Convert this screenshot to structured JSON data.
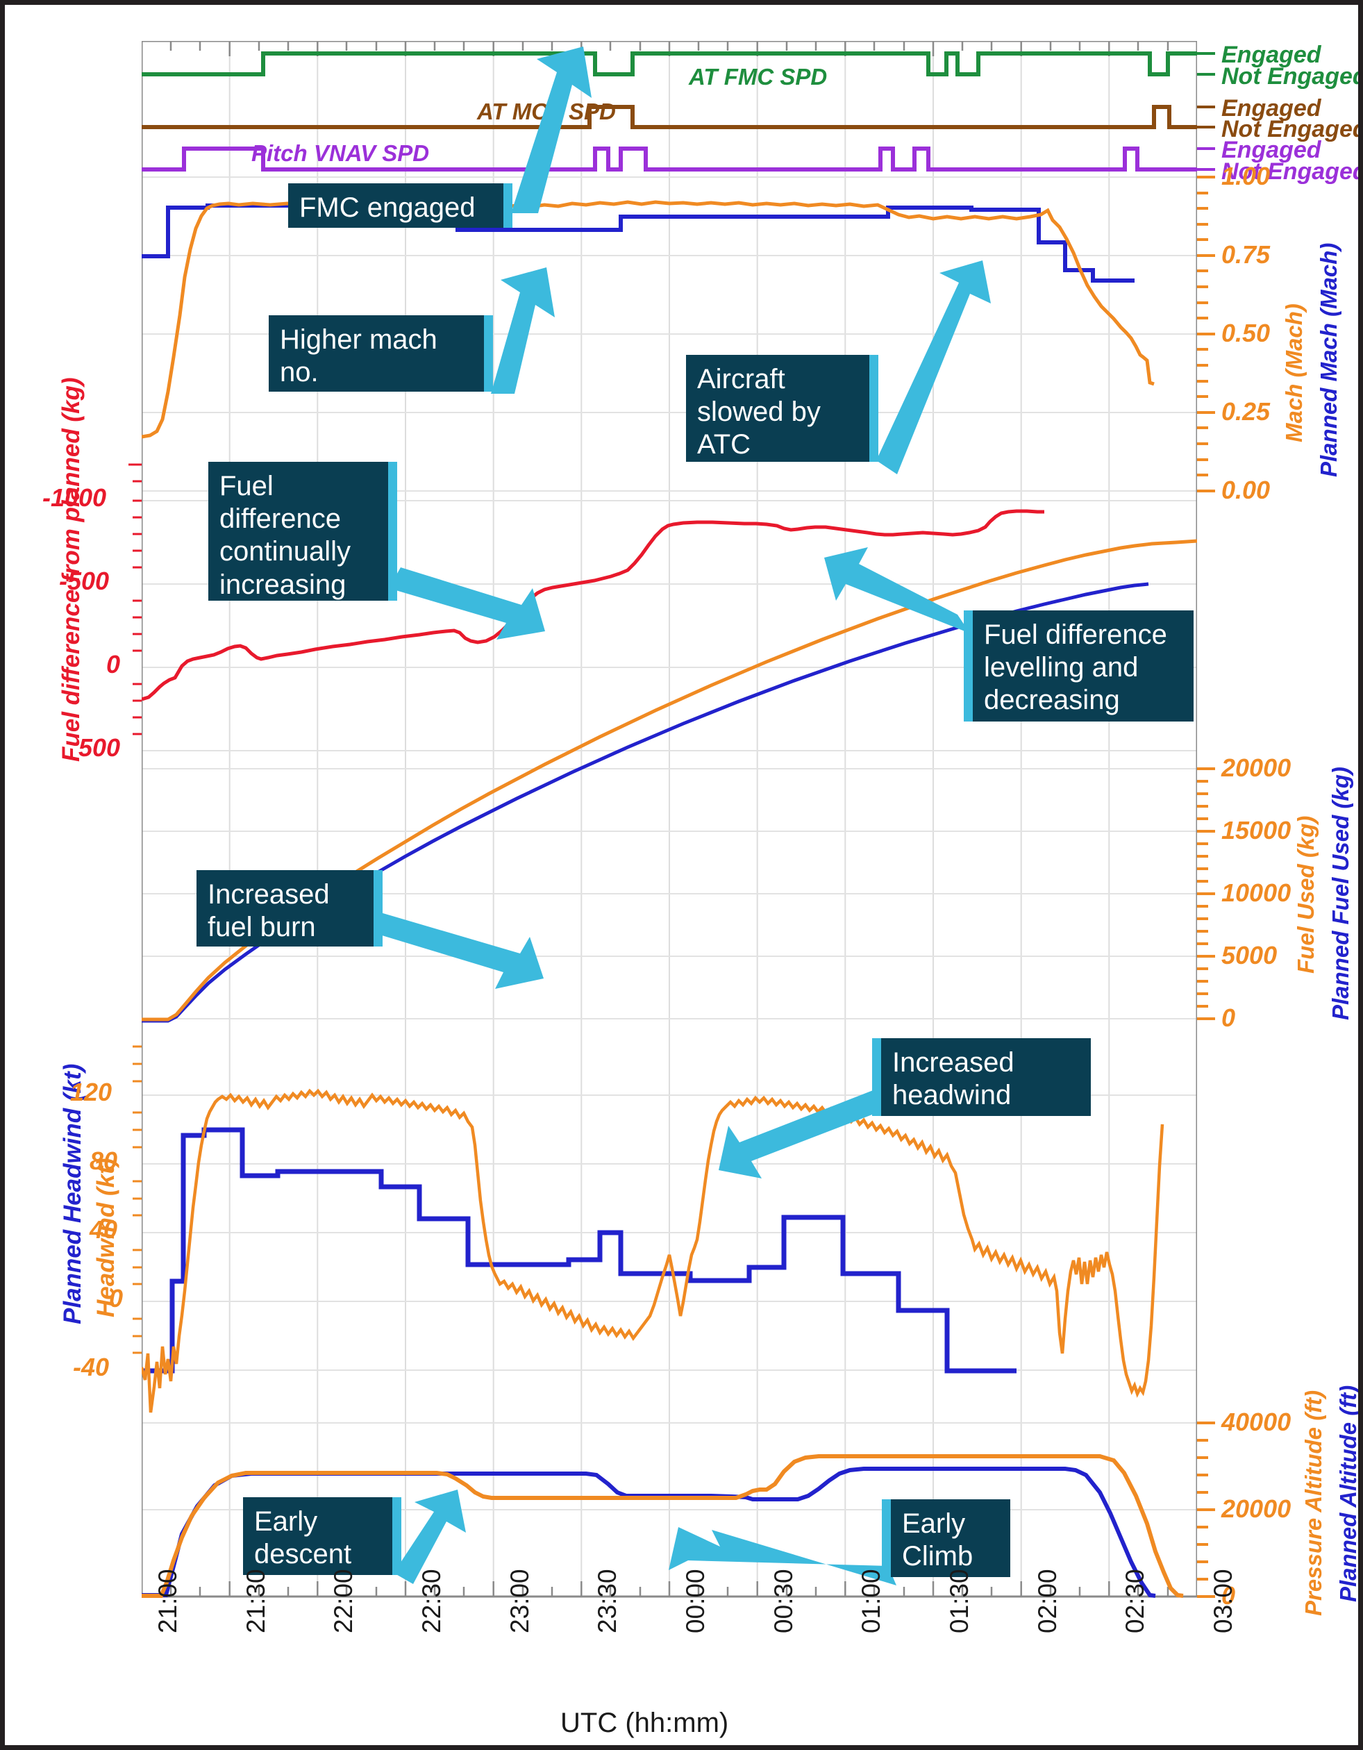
{
  "chart_data": {
    "type": "line",
    "title": "",
    "xlabel": "UTC (hh:mm)",
    "x_ticks": [
      "21:00",
      "21:30",
      "22:00",
      "22:30",
      "23:00",
      "23:30",
      "00:00",
      "00:30",
      "01:00",
      "01:30",
      "02:00",
      "02:30",
      "03:00"
    ],
    "x_range": [
      "21:00",
      "03:00"
    ],
    "grid": true,
    "panels": [
      {
        "name": "autopilot-modes",
        "axes": [
          {
            "side": "right",
            "label": "AT FMC SPD",
            "color": "#1e8e3e",
            "ticks": [
              "Engaged",
              "Not Engaged"
            ]
          },
          {
            "side": "right",
            "label": "AT MCP SPD",
            "color": "#8a4b10",
            "ticks": [
              "Engaged",
              "Not Engaged"
            ]
          },
          {
            "side": "right",
            "label": "Pitch VNAV SPD",
            "color": "#9b30d9",
            "ticks": [
              "Engaged",
              "Not Engaged"
            ]
          }
        ],
        "series": [
          {
            "name": "AT FMC SPD",
            "color": "#1e8e3e",
            "type": "step",
            "states": [
              [
                0.0,
                0
              ],
              [
                0.115,
                1
              ],
              [
                0.43,
                0
              ],
              [
                0.465,
                1
              ],
              [
                0.745,
                0
              ],
              [
                0.762,
                1
              ],
              [
                0.775,
                0
              ],
              [
                0.792,
                1
              ],
              [
                0.955,
                0
              ],
              [
                0.968,
                1
              ],
              [
                1.0,
                1
              ]
            ]
          },
          {
            "name": "AT MCP SPD",
            "color": "#8a4b10",
            "type": "step",
            "states": [
              [
                0.0,
                0
              ],
              [
                0.425,
                1
              ],
              [
                0.465,
                0
              ],
              [
                0.955,
                0
              ],
              [
                0.962,
                1
              ],
              [
                0.975,
                0
              ],
              [
                1.0,
                0
              ]
            ]
          },
          {
            "name": "Pitch VNAV SPD",
            "color": "#9b30d9",
            "type": "step",
            "states": [
              [
                0.0,
                0
              ],
              [
                0.04,
                1
              ],
              [
                0.115,
                0
              ],
              [
                0.425,
                0
              ],
              [
                0.435,
                1
              ],
              [
                0.448,
                0
              ],
              [
                0.458,
                1
              ],
              [
                0.478,
                0
              ],
              [
                0.7,
                1
              ],
              [
                0.712,
                0
              ],
              [
                0.728,
                1
              ],
              [
                0.742,
                0
              ],
              [
                0.93,
                1
              ],
              [
                0.94,
                0
              ],
              [
                1.0,
                0
              ]
            ]
          }
        ]
      },
      {
        "name": "mach",
        "axes": [
          {
            "side": "right",
            "label": "Mach (Mach)",
            "color": "#f08a22",
            "ticks": [
              "0.00",
              "0.25",
              "0.50",
              "0.75",
              "1.00"
            ],
            "range": [
              0,
              1
            ]
          },
          {
            "side": "right",
            "label": "Planned Mach (Mach)",
            "color": "#2222cc",
            "ticks": [
              "0.00",
              "0.25",
              "0.50",
              "0.75",
              "1.00"
            ],
            "range": [
              0,
              1
            ]
          }
        ],
        "series": [
          {
            "name": "Mach",
            "color": "#f08a22",
            "units": "Mach"
          },
          {
            "name": "Planned Mach",
            "color": "#2222cc",
            "units": "Mach"
          }
        ]
      },
      {
        "name": "fuel-difference",
        "axes": [
          {
            "side": "left",
            "label": "Fuel difference from planned (kg)",
            "color": "#e8192c",
            "ticks": [
              "-1000",
              "-500",
              "0",
              "500"
            ],
            "range": [
              500,
              -1000
            ],
            "inverted": true
          }
        ],
        "series": [
          {
            "name": "Fuel difference from planned",
            "color": "#e8192c",
            "units": "kg"
          }
        ]
      },
      {
        "name": "fuel-used",
        "axes": [
          {
            "side": "right",
            "label": "Fuel Used (kg)",
            "color": "#f08a22",
            "ticks": [
              "0",
              "5000",
              "10000",
              "15000",
              "20000"
            ],
            "range": [
              0,
              20000
            ]
          },
          {
            "side": "right",
            "label": "Planned Fuel Used (kg)",
            "color": "#2222cc",
            "ticks": [
              "0",
              "5000",
              "10000",
              "15000",
              "20000"
            ],
            "range": [
              0,
              20000
            ]
          }
        ],
        "series": [
          {
            "name": "Fuel Used",
            "color": "#f08a22",
            "units": "kg"
          },
          {
            "name": "Planned Fuel Used",
            "color": "#2222cc",
            "units": "kg"
          }
        ]
      },
      {
        "name": "headwind",
        "axes": [
          {
            "side": "left",
            "label": "Headwind (kt)",
            "color": "#f08a22",
            "ticks": [
              "-40",
              "0",
              "40",
              "80",
              "120"
            ],
            "range": [
              -40,
              120
            ]
          },
          {
            "side": "left",
            "label": "Planned Headwind (kt)",
            "color": "#2222cc",
            "ticks": [
              "-40",
              "0",
              "40",
              "80",
              "120"
            ],
            "range": [
              -40,
              120
            ]
          }
        ],
        "series": [
          {
            "name": "Headwind",
            "color": "#f08a22",
            "units": "kt"
          },
          {
            "name": "Planned Headwind",
            "color": "#2222cc",
            "units": "kt"
          }
        ]
      },
      {
        "name": "altitude",
        "axes": [
          {
            "side": "right",
            "label": "Pressure Altitude (ft)",
            "color": "#f08a22",
            "ticks": [
              "0",
              "20000",
              "40000"
            ],
            "range": [
              0,
              40000
            ]
          },
          {
            "side": "right",
            "label": "Planned Altitude (ft)",
            "color": "#2222cc",
            "ticks": [
              "0",
              "20000",
              "40000"
            ],
            "range": [
              0,
              40000
            ]
          }
        ],
        "series": [
          {
            "name": "Pressure Altitude",
            "color": "#f08a22",
            "units": "ft"
          },
          {
            "name": "Planned Altitude",
            "color": "#2222cc",
            "units": "ft"
          }
        ]
      }
    ],
    "annotations": [
      {
        "id": "fmc-engaged",
        "text": "FMC engaged",
        "bar": "right"
      },
      {
        "id": "higher-mach-no",
        "text": "Higher mach no.",
        "bar": "right"
      },
      {
        "id": "aircraft-slowed-by-atc",
        "text": "Aircraft slowed by ATC",
        "bar": "right"
      },
      {
        "id": "fuel-difference-continually-increasing",
        "text": "Fuel difference continually increasing",
        "bar": "right"
      },
      {
        "id": "fuel-difference-levelling-and-decreasing",
        "text": "Fuel difference levelling and decreasing",
        "bar": "left"
      },
      {
        "id": "increased-fuel-burn",
        "text": "Increased fuel burn",
        "bar": "right"
      },
      {
        "id": "increased-headwind",
        "text": "Increased headwind",
        "bar": "left"
      },
      {
        "id": "early-descent",
        "text": "Early descent",
        "bar": "right"
      },
      {
        "id": "early-climb",
        "text": "Early Climb",
        "bar": "left"
      }
    ],
    "colors": {
      "actual": "#f08a22",
      "planned": "#2222cc",
      "fuel_diff": "#e8192c",
      "fmc": "#1e8e3e",
      "mcp": "#8a4b10",
      "vnav": "#9b30d9",
      "annotation_bg": "#0a3e52",
      "annotation_accent": "#3cbadd",
      "grid": "#d9d9d9"
    }
  },
  "axis_titles": {
    "x": "UTC (hh:mm)",
    "fuel_difference": "Fuel difference from planned (kg)",
    "planned_headwind": "Planned Headwind (kt)",
    "headwind": "Headwind (kt)",
    "mach": "Mach (Mach)",
    "planned_mach": "Planned Mach (Mach)",
    "fuel_used": "Fuel Used (kg)",
    "planned_fuel_used": "Planned Fuel Used (kg)",
    "pressure_altitude": "Pressure Altitude (ft)",
    "planned_altitude": "Planned Altitude (ft)"
  },
  "series_labels": {
    "fmc": "AT FMC SPD",
    "mcp": "AT MCP SPD",
    "vnav": "Pitch VNAV SPD"
  },
  "state_labels": {
    "engaged": "Engaged",
    "not_engaged": "Not Engaged"
  },
  "ticks": {
    "x": [
      "21:00",
      "21:30",
      "22:00",
      "22:30",
      "23:00",
      "23:30",
      "00:00",
      "00:30",
      "01:00",
      "01:30",
      "02:00",
      "02:30",
      "03:00"
    ],
    "mach": [
      "1.00",
      "0.75",
      "0.50",
      "0.25",
      "0.00"
    ],
    "fuel_diff": [
      "-1000",
      "-500",
      "0",
      "500"
    ],
    "fuel_used": [
      "20000",
      "15000",
      "10000",
      "5000",
      "0"
    ],
    "headwind": [
      "120",
      "80",
      "40",
      "0",
      "-40"
    ],
    "altitude": [
      "40000",
      "20000",
      "0"
    ]
  },
  "annotations": {
    "fmc_engaged": "FMC engaged",
    "higher_mach": "Higher mach\nno.",
    "slowed_by_atc": "Aircraft\nslowed by\nATC",
    "fuel_increasing": "Fuel\ndifference\ncontinually\nincreasing",
    "fuel_levelling": "Fuel difference\nlevelling and\ndecreasing",
    "increased_fuel_burn": "Increased\nfuel burn",
    "increased_headwind": "Increased\nheadwind",
    "early_descent": "Early\ndescent",
    "early_climb": "Early\nClimb"
  }
}
